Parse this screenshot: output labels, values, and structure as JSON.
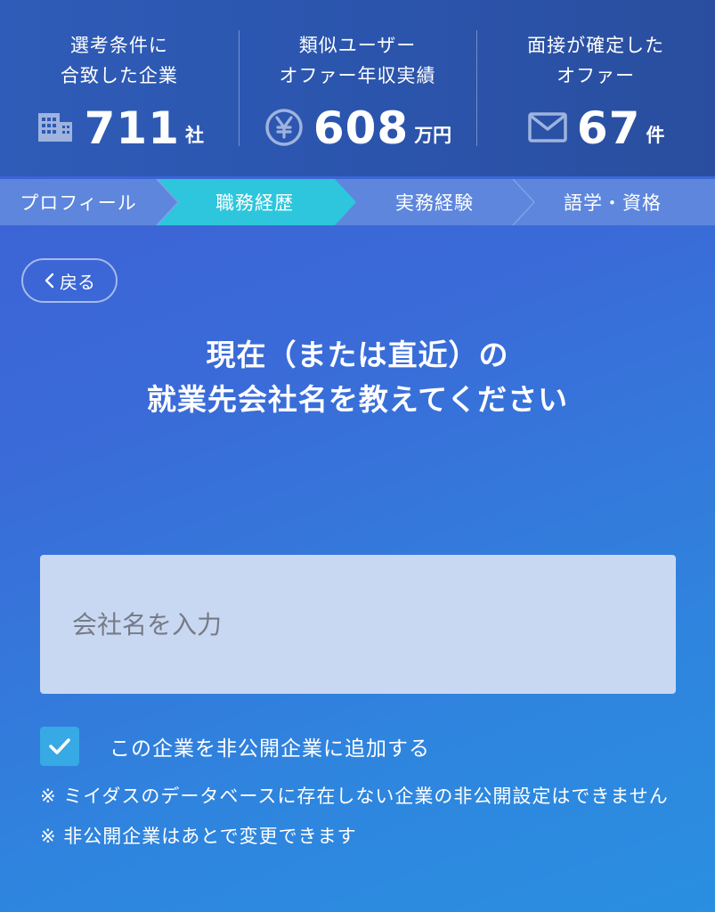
{
  "stats": [
    {
      "label_line1": "選考条件に",
      "label_line2": "合致した企業",
      "icon": "building-icon",
      "value": "711",
      "unit": "社"
    },
    {
      "label_line1": "類似ユーザー",
      "label_line2": "オファー年収実績",
      "icon": "yen-icon",
      "value": "608",
      "unit": "万円"
    },
    {
      "label_line1": "面接が確定した",
      "label_line2": "オファー",
      "icon": "mail-icon",
      "value": "67",
      "unit": "件"
    }
  ],
  "steps": [
    {
      "label": "プロフィール",
      "active": false
    },
    {
      "label": "職務経歴",
      "active": true
    },
    {
      "label": "実務経験",
      "active": false
    },
    {
      "label": "語学・資格",
      "active": false
    }
  ],
  "back": {
    "label": "戻る"
  },
  "question": {
    "line1": "現在（または直近）の",
    "line2": "就業先会社名を教えてください"
  },
  "company_input": {
    "placeholder": "会社名を入力",
    "value": ""
  },
  "private_checkbox": {
    "label": "この企業を非公開企業に追加する",
    "checked": true
  },
  "notes": [
    "※ ミイダスのデータベースに存在しない企業の非公開設定はできません",
    "※ 非公開企業はあとで変更できます"
  ],
  "colors": {
    "accent_step": "#2ec6dc",
    "checkbox": "#37a9e5",
    "input_bg": "#c9d8f2"
  }
}
